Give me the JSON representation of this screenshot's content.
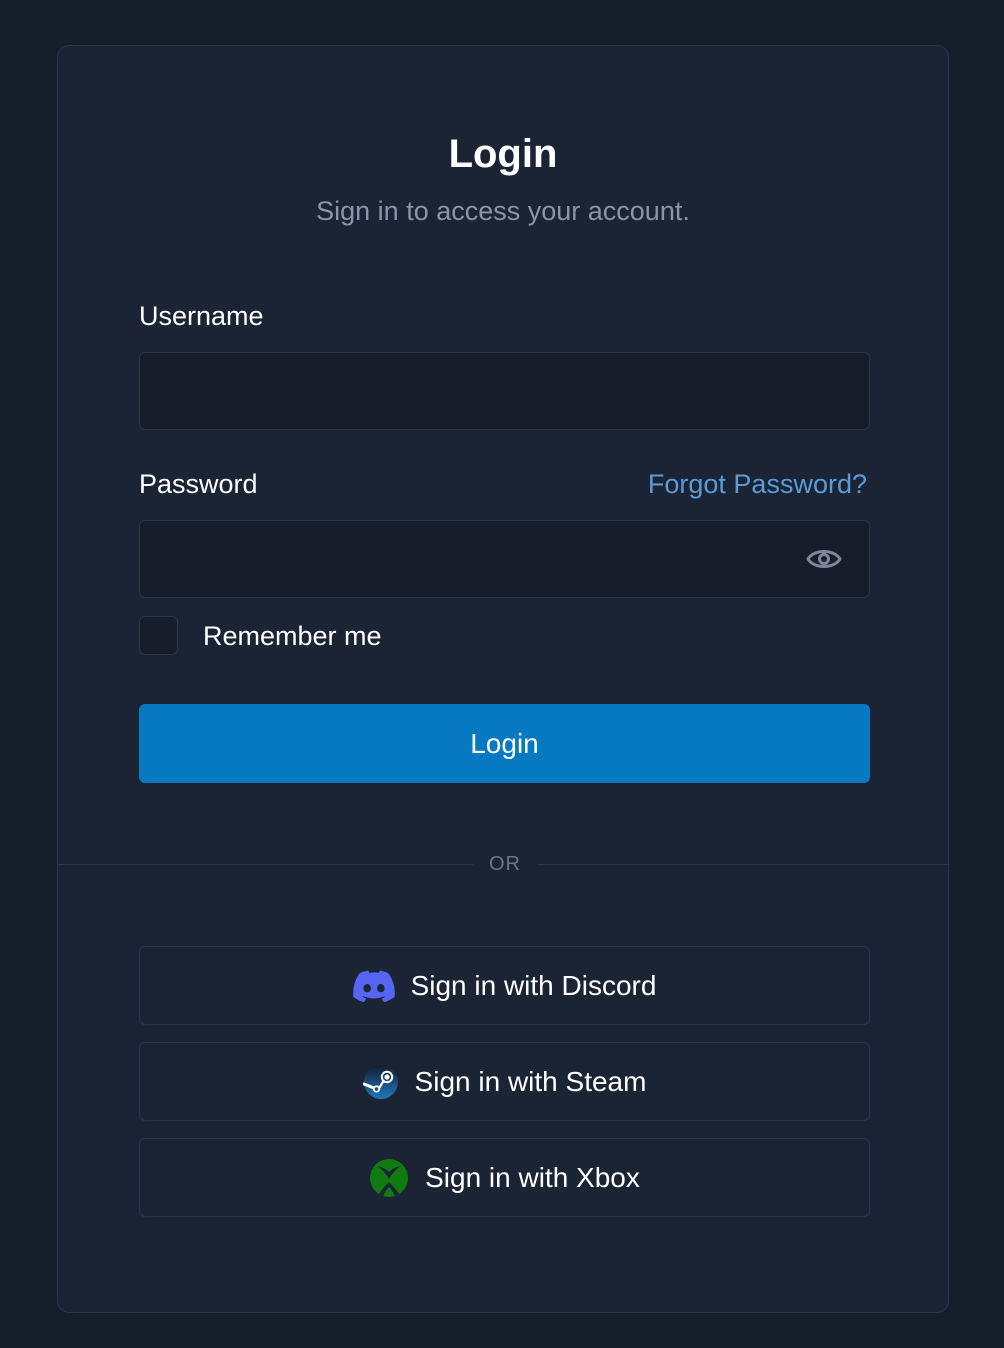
{
  "header": {
    "title": "Login",
    "subtitle": "Sign in to access your account."
  },
  "form": {
    "username_label": "Username",
    "username_value": "",
    "password_label": "Password",
    "password_value": "",
    "forgot_password": "Forgot Password?",
    "remember_label": "Remember me",
    "remember_checked": false,
    "login_button": "Login"
  },
  "divider": {
    "text": "OR"
  },
  "social": {
    "discord": {
      "label": "Sign in with Discord",
      "icon": "discord-icon",
      "color": "#5865F2"
    },
    "steam": {
      "label": "Sign in with Steam",
      "icon": "steam-icon",
      "color": "#1b2838"
    },
    "xbox": {
      "label": "Sign in with Xbox",
      "icon": "xbox-icon",
      "color": "#107C10"
    }
  },
  "colors": {
    "background": "#151e2b",
    "card": "#1a2435",
    "accent": "#0778c2",
    "link": "#5b9bd5"
  }
}
